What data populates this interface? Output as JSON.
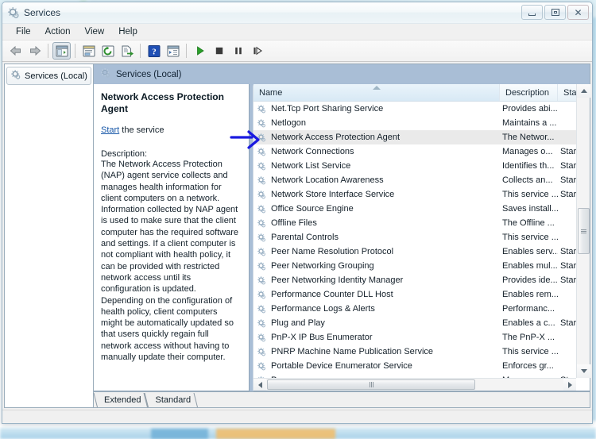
{
  "window": {
    "title": "Services",
    "icon": "services-gear-icon",
    "buttons": {
      "minimize": "Minimize",
      "maximize": "Restore",
      "close": "Close"
    }
  },
  "menu": {
    "items": [
      {
        "label": "File",
        "name": "menu-file"
      },
      {
        "label": "Action",
        "name": "menu-action"
      },
      {
        "label": "View",
        "name": "menu-view"
      },
      {
        "label": "Help",
        "name": "menu-help"
      }
    ]
  },
  "toolbar": {
    "buttons": [
      {
        "name": "back-button",
        "icon": "arrow-left-icon",
        "pressed": false
      },
      {
        "name": "forward-button",
        "icon": "arrow-right-icon",
        "pressed": false
      },
      {
        "name": "show-hide-console-tree-button",
        "icon": "console-tree-icon",
        "pressed": true
      },
      {
        "name": "properties-button",
        "icon": "properties-icon",
        "pressed": false
      },
      {
        "name": "refresh-button",
        "icon": "refresh-icon",
        "pressed": false
      },
      {
        "name": "export-list-button",
        "icon": "export-list-icon",
        "pressed": false
      },
      {
        "name": "help-button",
        "icon": "help-question-icon",
        "pressed": false
      },
      {
        "name": "show-action-pane-button",
        "icon": "action-pane-icon",
        "pressed": false
      },
      {
        "name": "start-service-button",
        "icon": "play-triangle-icon",
        "pressed": false
      },
      {
        "name": "stop-service-button",
        "icon": "stop-square-icon",
        "pressed": false
      },
      {
        "name": "pause-service-button",
        "icon": "pause-bars-icon",
        "pressed": false
      },
      {
        "name": "restart-service-button",
        "icon": "restart-icon",
        "pressed": false
      }
    ]
  },
  "tree": {
    "root": {
      "label": "Services (Local)",
      "icon": "services-gear-icon"
    }
  },
  "pane": {
    "header": {
      "label": "Services (Local)",
      "icon": "services-gear-icon"
    }
  },
  "details": {
    "title": "Network Access Protection Agent",
    "start_link": "Start",
    "start_suffix": " the service",
    "description_label": "Description:",
    "description": "The Network Access Protection (NAP) agent service collects and manages health information for client computers on a network. Information collected by NAP agent is used to make sure that the client computer has the required software and settings. If a client computer is not compliant with health policy, it can be provided with restricted network access until its configuration is updated. Depending on the configuration of health policy, client computers might be automatically updated so that users quickly regain full network access without having to manually update their computer."
  },
  "list": {
    "columns": [
      {
        "label": "Name",
        "name": "column-name",
        "sorted": true,
        "sort_direction": "ascending"
      },
      {
        "label": "Description",
        "name": "column-description",
        "sorted": false
      },
      {
        "label": "Stat",
        "name": "column-status",
        "sorted": false
      }
    ],
    "rows": [
      {
        "name": "Net.Tcp Port Sharing Service",
        "description": "Provides abi...",
        "status": "",
        "selected": false
      },
      {
        "name": "Netlogon",
        "description": "Maintains a ...",
        "status": "",
        "selected": false
      },
      {
        "name": "Network Access Protection Agent",
        "description": "The Networ...",
        "status": "",
        "selected": true
      },
      {
        "name": "Network Connections",
        "description": "Manages o...",
        "status": "Star",
        "selected": false
      },
      {
        "name": "Network List Service",
        "description": "Identifies th...",
        "status": "Star",
        "selected": false
      },
      {
        "name": "Network Location Awareness",
        "description": "Collects an...",
        "status": "Star",
        "selected": false
      },
      {
        "name": "Network Store Interface Service",
        "description": "This service ...",
        "status": "Star",
        "selected": false
      },
      {
        "name": "Office Source Engine",
        "description": "Saves install...",
        "status": "",
        "selected": false
      },
      {
        "name": "Offline Files",
        "description": "The Offline ...",
        "status": "",
        "selected": false
      },
      {
        "name": "Parental Controls",
        "description": "This service ...",
        "status": "",
        "selected": false
      },
      {
        "name": "Peer Name Resolution Protocol",
        "description": "Enables serv...",
        "status": "Star",
        "selected": false
      },
      {
        "name": "Peer Networking Grouping",
        "description": "Enables mul...",
        "status": "Star",
        "selected": false
      },
      {
        "name": "Peer Networking Identity Manager",
        "description": "Provides ide...",
        "status": "Star",
        "selected": false
      },
      {
        "name": "Performance Counter DLL Host",
        "description": "Enables rem...",
        "status": "",
        "selected": false
      },
      {
        "name": "Performance Logs & Alerts",
        "description": "Performanc...",
        "status": "",
        "selected": false
      },
      {
        "name": "Plug and Play",
        "description": "Enables a c...",
        "status": "Star",
        "selected": false
      },
      {
        "name": "PnP-X IP Bus Enumerator",
        "description": "The PnP-X ...",
        "status": "",
        "selected": false
      },
      {
        "name": "PNRP Machine Name Publication Service",
        "description": "This service ...",
        "status": "",
        "selected": false
      },
      {
        "name": "Portable Device Enumerator Service",
        "description": "Enforces gr...",
        "status": "",
        "selected": false
      },
      {
        "name": "Power",
        "description": "Manages p...",
        "status": "Star",
        "selected": false
      }
    ]
  },
  "tabs": [
    {
      "label": "Extended",
      "name": "tab-extended",
      "active": true
    },
    {
      "label": "Standard",
      "name": "tab-standard",
      "active": false
    }
  ],
  "annotation": {
    "type": "pointer-arrow",
    "color": "#1a1ae0",
    "target": "Network Access Protection Agent"
  },
  "colors": {
    "accent_header": "#a9bed6",
    "selection": "#eaeaea",
    "link": "#1757a8",
    "window_border": "#9bb4c6",
    "annotation": "#1a1ae0"
  }
}
